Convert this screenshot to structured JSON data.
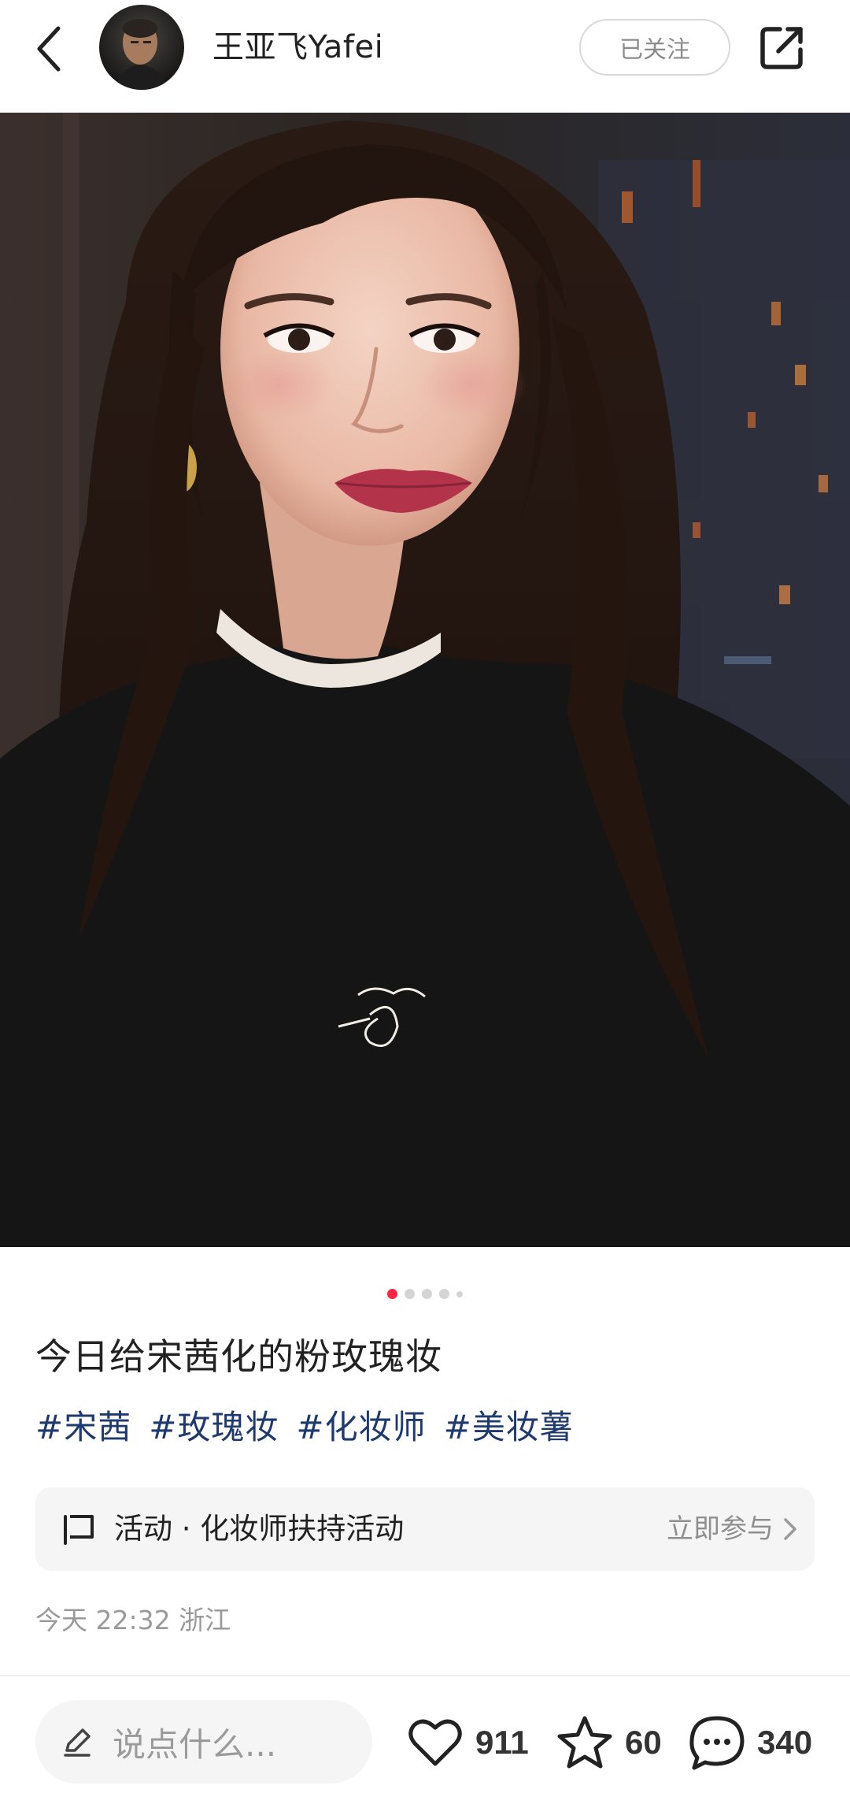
{
  "header": {
    "author_name": "王亚飞Yafei",
    "follow_label": "已关注"
  },
  "post": {
    "image_count_dots": 5,
    "active_dot": 0,
    "title": "今日给宋茜化的粉玫瑰妆",
    "tags": [
      "#宋茜",
      "#玫瑰妆",
      "#化妆师",
      "#美妆薯"
    ],
    "activity": {
      "label": "活动 · 化妆师扶持活动",
      "cta": "立即参与"
    },
    "meta": "今天 22:32 浙江"
  },
  "bottom_bar": {
    "comment_placeholder": "说点什么...",
    "like_count": "911",
    "collect_count": "60",
    "comment_count": "340"
  },
  "colors": {
    "accent": "#ff2442",
    "tag": "#1f3a6e",
    "muted": "#9a9a9a"
  },
  "icons": {
    "back": "chevron-left-icon",
    "share": "share-icon",
    "activity": "flag-icon",
    "pencil": "pencil-icon",
    "like": "heart-icon",
    "collect": "star-icon",
    "comment": "chat-bubble-icon"
  }
}
